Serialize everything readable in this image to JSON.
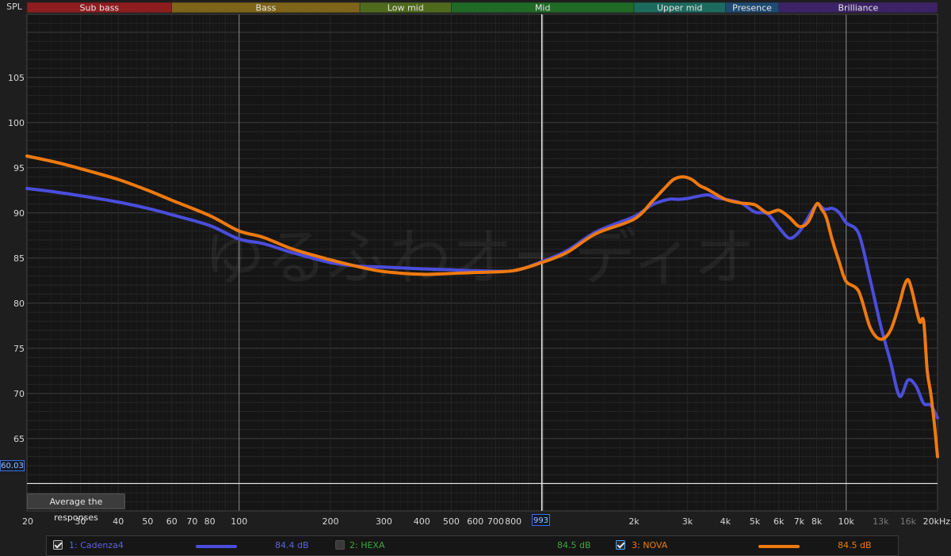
{
  "bands": [
    {
      "label": "Sub bass",
      "from": 20,
      "to": 60,
      "color": "#8e1d20"
    },
    {
      "label": "Bass",
      "from": 60,
      "to": 250,
      "color": "#7e6418"
    },
    {
      "label": "Low mid",
      "from": 250,
      "to": 500,
      "color": "#4f6a1c"
    },
    {
      "label": "Mid",
      "from": 500,
      "to": 2000,
      "color": "#1f6a25"
    },
    {
      "label": "Upper mid",
      "from": 2000,
      "to": 4000,
      "color": "#1d6a5e"
    },
    {
      "label": "Presence",
      "from": 4000,
      "to": 6000,
      "color": "#1f4a72"
    },
    {
      "label": "Brilliance",
      "from": 6000,
      "to": 20000,
      "color": "#3c2266"
    }
  ],
  "y_axis_title": "SPL",
  "watermark": "ゆるふわオーディオ",
  "average_button_label": "Average the responses",
  "cursor": {
    "x_label": "993",
    "y_label": "60.03"
  },
  "chart_data": {
    "type": "line",
    "xlabel": "",
    "ylabel": "SPL",
    "x_scale": "log",
    "xlim": [
      20,
      20000
    ],
    "ylim": [
      57,
      112
    ],
    "grid": true,
    "x_tick_labels": [
      {
        "v": 20,
        "t": "20"
      },
      {
        "v": 30,
        "t": "30"
      },
      {
        "v": 40,
        "t": "40"
      },
      {
        "v": 50,
        "t": "50"
      },
      {
        "v": 60,
        "t": "60"
      },
      {
        "v": 70,
        "t": "70"
      },
      {
        "v": 80,
        "t": "80"
      },
      {
        "v": 100,
        "t": "100"
      },
      {
        "v": 200,
        "t": "200"
      },
      {
        "v": 300,
        "t": "300"
      },
      {
        "v": 400,
        "t": "400"
      },
      {
        "v": 500,
        "t": "500"
      },
      {
        "v": 600,
        "t": "600"
      },
      {
        "v": 700,
        "t": "700"
      },
      {
        "v": 800,
        "t": "800"
      },
      {
        "v": 2000,
        "t": "2k"
      },
      {
        "v": 3000,
        "t": "3k"
      },
      {
        "v": 4000,
        "t": "4k"
      },
      {
        "v": 5000,
        "t": "5k"
      },
      {
        "v": 6000,
        "t": "6k"
      },
      {
        "v": 7000,
        "t": "7k"
      },
      {
        "v": 8000,
        "t": "8k"
      },
      {
        "v": 10000,
        "t": "10k"
      },
      {
        "v": 13000,
        "t": "13k",
        "dim": true
      },
      {
        "v": 16000,
        "t": "16k",
        "dim": true
      },
      {
        "v": 20000,
        "t": "20kHz"
      }
    ],
    "y_ticks": [
      65,
      70,
      75,
      80,
      85,
      90,
      95,
      100,
      105
    ],
    "series": [
      {
        "name": "1: Cadenza4",
        "color": "#4b4ddd",
        "x": [
          20,
          25,
          30,
          40,
          50,
          60,
          80,
          100,
          120,
          150,
          200,
          250,
          300,
          400,
          500,
          600,
          800,
          993,
          1200,
          1500,
          2000,
          2300,
          2600,
          2800,
          3000,
          3200,
          3500,
          3700,
          4000,
          4500,
          5000,
          5500,
          6000,
          6500,
          7000,
          7500,
          8000,
          8500,
          9000,
          9500,
          10000,
          11000,
          12000,
          13000,
          14000,
          15000,
          16000,
          17000,
          18000,
          19000,
          20000
        ],
        "y": [
          92.7,
          92.3,
          91.9,
          91.2,
          90.5,
          89.8,
          88.6,
          87.1,
          86.6,
          85.6,
          84.5,
          84.1,
          84.0,
          83.8,
          83.7,
          83.6,
          83.6,
          84.6,
          85.8,
          87.9,
          89.6,
          90.9,
          91.5,
          91.5,
          91.6,
          91.8,
          92.0,
          91.7,
          91.5,
          91.1,
          90.1,
          89.9,
          88.4,
          87.2,
          87.9,
          89.5,
          90.9,
          90.4,
          90.5,
          90.0,
          88.9,
          87.7,
          82.6,
          77.5,
          73.5,
          69.7,
          71.5,
          70.8,
          68.9,
          68.7,
          67.3
        ]
      },
      {
        "name": "3: NOVA",
        "color": "#f0790f",
        "x": [
          20,
          25,
          30,
          40,
          50,
          60,
          80,
          100,
          120,
          150,
          200,
          250,
          300,
          400,
          500,
          600,
          800,
          993,
          1200,
          1500,
          2000,
          2300,
          2500,
          2700,
          2900,
          3100,
          3300,
          3500,
          4000,
          4500,
          5000,
          5500,
          6000,
          6500,
          7000,
          7500,
          8000,
          8300,
          8600,
          9000,
          9500,
          10000,
          11000,
          12000,
          13000,
          14000,
          15000,
          15500,
          16000,
          16500,
          17000,
          17500,
          18000,
          18500,
          19000,
          19500,
          20000
        ],
        "y": [
          96.3,
          95.6,
          94.9,
          93.7,
          92.5,
          91.4,
          89.7,
          88.0,
          87.3,
          86.0,
          84.8,
          84.0,
          83.5,
          83.2,
          83.3,
          83.4,
          83.6,
          84.5,
          85.6,
          87.7,
          89.3,
          91.3,
          92.6,
          93.7,
          94.0,
          93.7,
          93.0,
          92.6,
          91.5,
          91.1,
          90.9,
          90.0,
          90.3,
          89.5,
          88.5,
          89.0,
          91.0,
          90.4,
          89.5,
          87.0,
          84.5,
          82.4,
          81.3,
          77.3,
          76.0,
          77.0,
          80.0,
          81.8,
          82.6,
          81.3,
          79.4,
          77.9,
          78.0,
          72.5,
          70.0,
          66.8,
          63.0
        ]
      }
    ]
  },
  "legend": [
    {
      "index_label": "1: Cadenza4",
      "value": "84.4 dB",
      "checked": true,
      "color": "#4b4ddd",
      "text_color": "#5d61e6"
    },
    {
      "index_label": "2: HEXA",
      "value": "84.5 dB",
      "checked": false,
      "color": "#2f9d34",
      "text_color": "#3aa83f"
    },
    {
      "index_label": "3: NOVA",
      "value": "84.5 dB",
      "checked": true,
      "color": "#f0790f",
      "text_color": "#f0790f"
    }
  ]
}
